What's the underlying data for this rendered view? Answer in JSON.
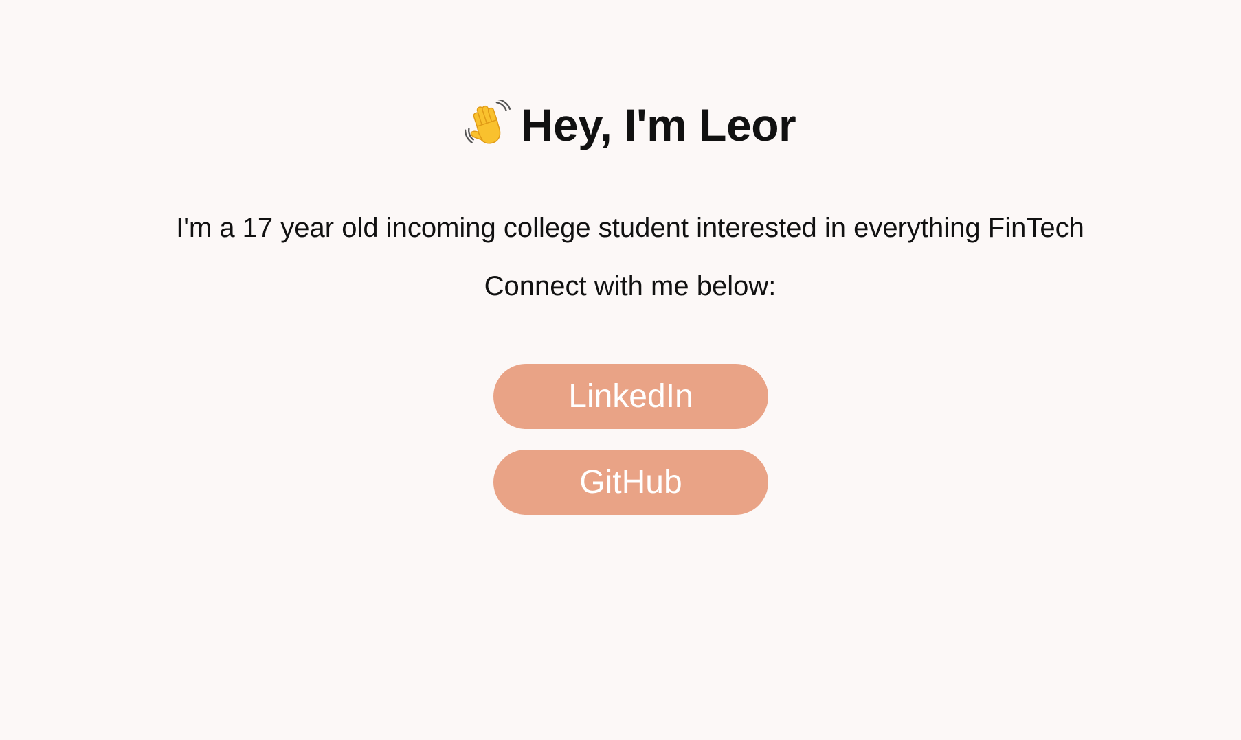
{
  "header": {
    "greeting_icon": "waving-hand-icon",
    "title": "Hey, I'm Leor"
  },
  "intro": {
    "tagline": "I'm a 17 year old incoming college student interested in everything FinTech",
    "connect_prompt": "Connect with me below:"
  },
  "links": [
    {
      "label": "LinkedIn"
    },
    {
      "label": "GitHub"
    }
  ],
  "colors": {
    "background": "#fcf8f7",
    "button_bg": "#e9a386",
    "button_text": "#ffffff",
    "text": "#111111"
  }
}
